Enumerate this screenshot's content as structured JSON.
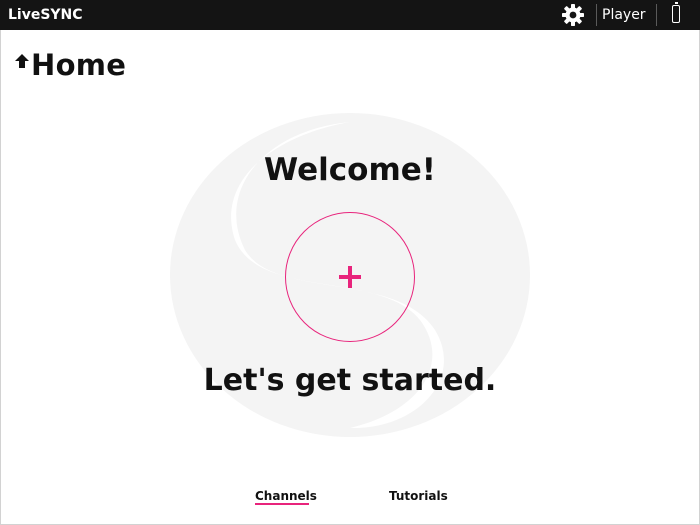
{
  "header": {
    "app_title": "LiveSYNC",
    "mode_label": "Player",
    "icons": [
      "gear-icon",
      "battery-icon"
    ]
  },
  "page": {
    "title": "Home",
    "title_icon": "home-arrow-icon"
  },
  "content": {
    "welcome": "Welcome!",
    "add_icon": "plus-icon",
    "subtitle": "Let's get started."
  },
  "tabs": [
    {
      "label": "Channels",
      "active": true
    },
    {
      "label": "Tutorials",
      "active": false
    }
  ],
  "colors": {
    "accent": "#e8247c",
    "topbar": "#141414",
    "background": "#ffffff"
  }
}
